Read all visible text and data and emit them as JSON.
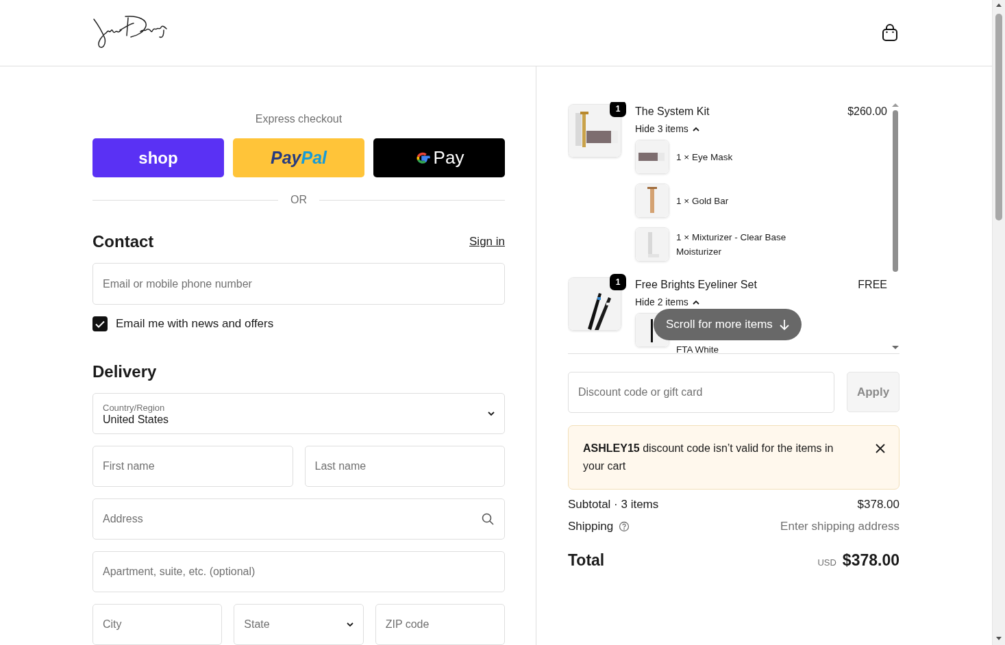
{
  "express_checkout": {
    "title": "Express checkout",
    "separator": "OR",
    "buttons": [
      {
        "kind": "shop",
        "label": "shop"
      },
      {
        "kind": "paypal",
        "label_parts": [
          "Pay",
          "Pal"
        ]
      },
      {
        "kind": "gpay",
        "label": "Pay"
      }
    ]
  },
  "contact": {
    "heading": "Contact",
    "sign_in": "Sign in",
    "email": {
      "placeholder": "Email or mobile phone number"
    },
    "newsletter": {
      "label": "Email me with news and offers",
      "checked": true
    }
  },
  "delivery": {
    "heading": "Delivery",
    "rows": [
      [
        {
          "kind": "select",
          "label": "Country/Region",
          "value": "United States"
        }
      ],
      [
        {
          "kind": "text",
          "placeholder": "First name"
        },
        {
          "kind": "text",
          "placeholder": "Last name"
        }
      ],
      [
        {
          "kind": "search",
          "placeholder": "Address"
        }
      ],
      [
        {
          "kind": "text",
          "placeholder": "Apartment, suite, etc. (optional)"
        }
      ],
      [
        {
          "kind": "text",
          "placeholder": "City"
        },
        {
          "kind": "select",
          "placeholder": "State"
        },
        {
          "kind": "text",
          "placeholder": "ZIP code"
        }
      ]
    ]
  },
  "cart": {
    "items": [
      {
        "name": "The System Kit",
        "price": "$260.00",
        "quantity": "1",
        "toggle": "Hide 3 items",
        "expanded": true,
        "children": [
          {
            "text": "1 × Eye Mask"
          },
          {
            "text": "1 × Gold Bar"
          },
          {
            "text": "1 × Mixturizer - Clear Base Moisturizer"
          }
        ]
      },
      {
        "name": "Free Brights Eyeliner Set",
        "price": "FREE",
        "quantity": "1",
        "toggle": "Hide 2 items",
        "expanded": true,
        "children": [
          {
            "text": "FTA White"
          }
        ]
      }
    ],
    "scroll_hint": "Scroll for more items"
  },
  "discount": {
    "placeholder": "Discount code or gift card",
    "apply": "Apply",
    "disabled": true
  },
  "alert": {
    "message": "**ASHLEY15** discount code isn’t valid for the items in your cart"
  },
  "summary": {
    "rows": [
      {
        "kind": "amount",
        "label": "Subtotal · 3 items",
        "value": "$378.00"
      },
      {
        "kind": "hint",
        "label": "Shipping",
        "value": "Enter shipping address"
      }
    ],
    "total": {
      "label": "Total",
      "currency": "USD",
      "value": "$378.00"
    }
  }
}
